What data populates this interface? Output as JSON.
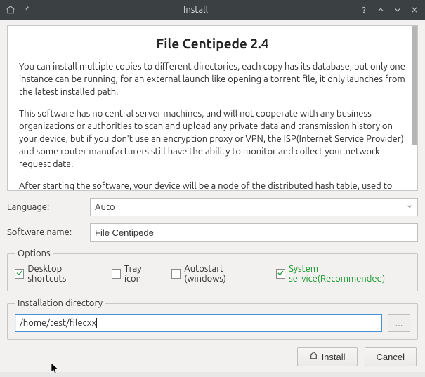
{
  "titlebar": {
    "title": "Install"
  },
  "description": {
    "heading": "File Centipede 2.4",
    "para1": "You can install multiple copies to different directories, each copy has its database, but only one instance can be running, for an external launch like opening a torrent file, it only launches from the latest installed path.",
    "para2": "This software has no central server machines, and will not cooperate with any business organizations or authorities to scan and upload any private data and transmission history on your device, but if you don't use an encryption proxy or VPN, the ISP(Internet Service Provider) and some router manufacturers still have the ability to monitor and collect your network request data.",
    "para3": "After starting the software, your device will be a node of the distributed hash table, used to store torrent metadata corresponding to magnet links shared by other users from the distributed network, it will consume a very small amount of network traffic and RAM, which is used to help"
  },
  "form": {
    "language_label": "Language:",
    "language_value": "Auto",
    "softwarename_label": "Software name:",
    "softwarename_value": "File Centipede"
  },
  "options": {
    "legend": "Options",
    "desktop_shortcuts": "Desktop shortcuts",
    "tray_icon": "Tray icon",
    "autostart": "Autostart (windows)",
    "system_service": "System service(Recommended)"
  },
  "install_dir": {
    "legend": "Installation directory",
    "path": "/home/test/filecxx",
    "browse": "..."
  },
  "footer": {
    "install": "Install",
    "cancel": "Cancel"
  }
}
